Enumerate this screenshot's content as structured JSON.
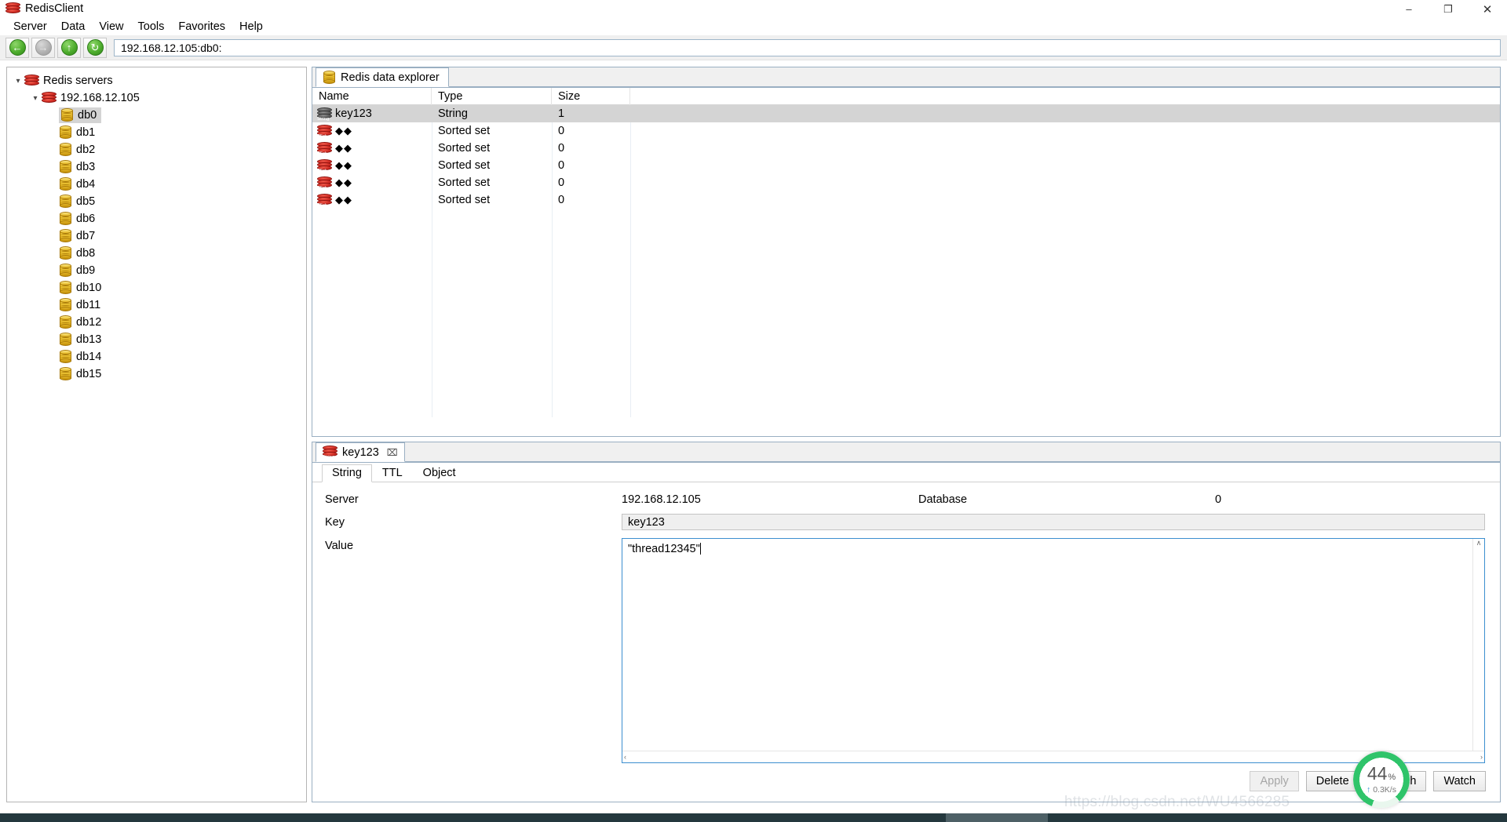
{
  "window": {
    "title": "RedisClient",
    "app_icon": "redis-stack-icon",
    "controls": {
      "minimize": "–",
      "restore": "❐",
      "close": "✕"
    }
  },
  "menubar": {
    "items": [
      "Server",
      "Data",
      "View",
      "Tools",
      "Favorites",
      "Help"
    ]
  },
  "toolbar": {
    "buttons": [
      {
        "name": "back-button",
        "icon": "arrow-left-icon",
        "glyph": "←",
        "enabled": true
      },
      {
        "name": "forward-button",
        "icon": "arrow-right-icon",
        "glyph": "→",
        "enabled": false
      },
      {
        "name": "up-button",
        "icon": "arrow-up-icon",
        "glyph": "↑",
        "enabled": true
      },
      {
        "name": "refresh-button",
        "icon": "refresh-icon",
        "glyph": "↻",
        "enabled": true
      }
    ],
    "address": "192.168.12.105:db0:"
  },
  "sidebar": {
    "root": {
      "label": "Redis servers",
      "icon": "redis-stack-icon",
      "expanded": true
    },
    "server": {
      "label": "192.168.12.105",
      "icon": "redis-stack-icon",
      "expanded": true
    },
    "databases": [
      "db0",
      "db1",
      "db2",
      "db3",
      "db4",
      "db5",
      "db6",
      "db7",
      "db8",
      "db9",
      "db10",
      "db11",
      "db12",
      "db13",
      "db14",
      "db15"
    ],
    "selected": "db0"
  },
  "explorer": {
    "tab": {
      "label": "Redis data explorer",
      "icon": "database-icon"
    },
    "columns": [
      "Name",
      "Type",
      "Size"
    ],
    "rows": [
      {
        "name": "key123",
        "type": "String",
        "size": "1",
        "icon": "redis-string-icon",
        "icon_tag": "String",
        "selected": true
      },
      {
        "name": "◆◆",
        "type": "Sorted set",
        "size": "0",
        "icon": "redis-zset-icon",
        "icon_tag": "ZSet",
        "selected": false
      },
      {
        "name": "◆◆",
        "type": "Sorted set",
        "size": "0",
        "icon": "redis-zset-icon",
        "icon_tag": "ZSet",
        "selected": false
      },
      {
        "name": "◆◆",
        "type": "Sorted set",
        "size": "0",
        "icon": "redis-zset-icon",
        "icon_tag": "ZSet",
        "selected": false
      },
      {
        "name": "◆◆",
        "type": "Sorted set",
        "size": "0",
        "icon": "redis-zset-icon",
        "icon_tag": "ZSet",
        "selected": false
      },
      {
        "name": "◆◆",
        "type": "Sorted set",
        "size": "0",
        "icon": "redis-zset-icon",
        "icon_tag": "ZSet",
        "selected": false
      }
    ]
  },
  "editor": {
    "tab": {
      "label": "key123",
      "icon": "redis-string-icon",
      "icon_tag": "String",
      "close": "⌧"
    },
    "subtabs": [
      {
        "label": "String",
        "active": true
      },
      {
        "label": "TTL",
        "active": false
      },
      {
        "label": "Object",
        "active": false
      }
    ],
    "fields": {
      "server_label": "Server",
      "server_value": "192.168.12.105",
      "database_label": "Database",
      "database_value": "0",
      "key_label": "Key",
      "key_value": "key123",
      "value_label": "Value",
      "value_text": "\"thread12345\""
    },
    "scroll": {
      "up": "∧",
      "left": "‹",
      "right": "›"
    },
    "buttons": [
      {
        "label": "Apply",
        "enabled": false
      },
      {
        "label": "Delete",
        "enabled": true
      },
      {
        "label": "Refresh",
        "enabled": true
      },
      {
        "label": "Watch",
        "enabled": true
      }
    ]
  },
  "net_widget": {
    "percent": "44",
    "percent_unit": "%",
    "rate": "0.3K/s",
    "up_arrow": "↑"
  },
  "watermark": "https://blog.csdn.net/WU4566285",
  "colors": {
    "redis_red": "#cf2a22",
    "db_gold": "#e7b821",
    "selection_gray": "#d4d4d4",
    "focus_blue": "#3c8fd0",
    "net_green": "#2fc46a",
    "panel_border": "#9aafc2"
  }
}
